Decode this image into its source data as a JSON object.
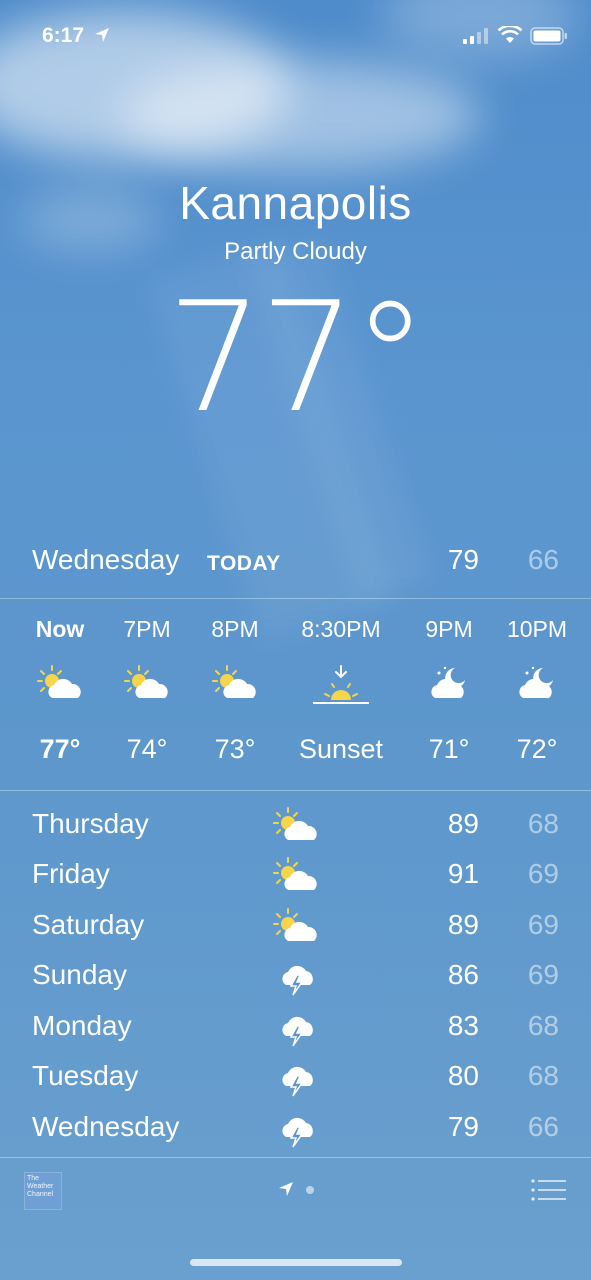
{
  "status_bar": {
    "time": "6:17"
  },
  "location": {
    "city": "Kannapolis",
    "condition": "Partly Cloudy",
    "temperature": "77°"
  },
  "today": {
    "day": "Wednesday",
    "tag": "TODAY",
    "high": "79",
    "low": "66"
  },
  "hourly": [
    {
      "label": "Now",
      "icon": "partly-cloudy-day-icon",
      "temp": "77°"
    },
    {
      "label": "7PM",
      "icon": "partly-cloudy-day-icon",
      "temp": "74°"
    },
    {
      "label": "8PM",
      "icon": "partly-cloudy-day-icon",
      "temp": "73°"
    },
    {
      "label": "8:30PM",
      "icon": "sunset-icon",
      "temp": "Sunset"
    },
    {
      "label": "9PM",
      "icon": "partly-cloudy-night-icon",
      "temp": "71°"
    },
    {
      "label": "10PM",
      "icon": "partly-cloudy-night-icon",
      "temp": "72°"
    }
  ],
  "daily": [
    {
      "day": "Thursday",
      "icon": "partly-cloudy-day-icon",
      "high": "89",
      "low": "68"
    },
    {
      "day": "Friday",
      "icon": "partly-cloudy-day-icon",
      "high": "91",
      "low": "69"
    },
    {
      "day": "Saturday",
      "icon": "partly-cloudy-day-icon",
      "high": "89",
      "low": "69"
    },
    {
      "day": "Sunday",
      "icon": "thunderstorm-icon",
      "high": "86",
      "low": "69"
    },
    {
      "day": "Monday",
      "icon": "thunderstorm-icon",
      "high": "83",
      "low": "68"
    },
    {
      "day": "Tuesday",
      "icon": "thunderstorm-icon",
      "high": "80",
      "low": "68"
    },
    {
      "day": "Wednesday",
      "icon": "thunderstorm-icon",
      "high": "79",
      "low": "66"
    }
  ],
  "footer": {
    "logo_text": "The Weather Channel"
  },
  "colors": {
    "sun": "#f6d54a",
    "cloud": "#ffffff",
    "background": "#5a95cf"
  }
}
